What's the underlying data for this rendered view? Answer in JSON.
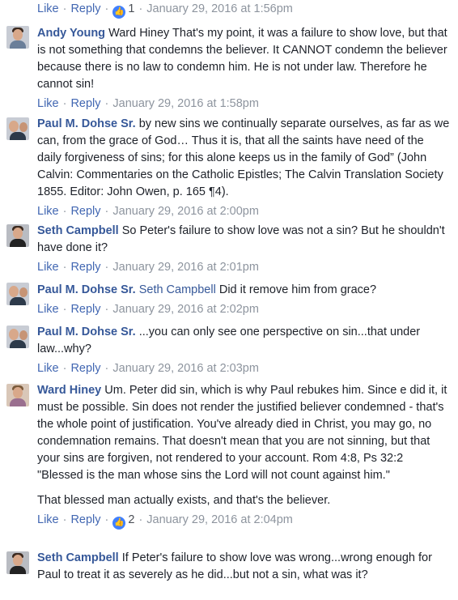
{
  "top_actions": {
    "like": "Like",
    "reply": "Reply",
    "likes": "1",
    "time": "January 29, 2016 at 1:56pm"
  },
  "comments": [
    {
      "name": "Andy Young",
      "text": "Ward Hiney That's my point, it was a failure to show love, but that is not something that condemns the believer. It CANNOT condemn the believer because there is no law to condemn him. He is not under law. Therefore he cannot sin!",
      "like": "Like",
      "reply": "Reply",
      "time": "January 29, 2016 at 1:58pm"
    },
    {
      "name": "Paul M. Dohse Sr.",
      "text": "by new sins we continually separate ourselves, as far as we can, from the grace of God… Thus it is, that all the saints have need of the daily forgiveness of sins; for this alone keeps us in the family of God” (John Calvin: Commentaries on the Catholic Epistles; The Calvin Translation Society 1855. Editor: John Owen, p. 165 ¶4).",
      "like": "Like",
      "reply": "Reply",
      "time": "January 29, 2016 at 2:00pm"
    },
    {
      "name": "Seth Campbell",
      "text": "So Peter's failure to show love was not a sin? But he shouldn't have done it?",
      "like": "Like",
      "reply": "Reply",
      "time": "January 29, 2016 at 2:01pm"
    },
    {
      "name": "Paul M. Dohse Sr.",
      "mention": "Seth Campbell",
      "text": "Did it remove him from grace?",
      "like": "Like",
      "reply": "Reply",
      "time": "January 29, 2016 at 2:02pm"
    },
    {
      "name": "Paul M. Dohse Sr.",
      "text": "...you can only see one perspective on sin...that under law...why?",
      "like": "Like",
      "reply": "Reply",
      "time": "January 29, 2016 at 2:03pm"
    },
    {
      "name": "Ward Hiney",
      "text": "Um. Peter did sin, which is why Paul rebukes him. Since e did it, it must be possible. Sin does not render the justified believer condemned - that's the whole point of justification. You've already died in Christ, you may go, no condemnation remains. That doesn't mean that you are not sinning, but that your sins are forgiven, not rendered to your account. Rom 4:8, Ps 32:2 \"Blessed is the man whose sins the Lord will not count against him.\"",
      "text2": "That blessed man actually exists, and that's the believer.",
      "like": "Like",
      "reply": "Reply",
      "likes": "2",
      "time": "January 29, 2016 at 2:04pm"
    },
    {
      "name": "Seth Campbell",
      "text": "If Peter's failure to show love was wrong...wrong enough for Paul to treat it as severely as he did...but not a sin, what was it?"
    }
  ]
}
